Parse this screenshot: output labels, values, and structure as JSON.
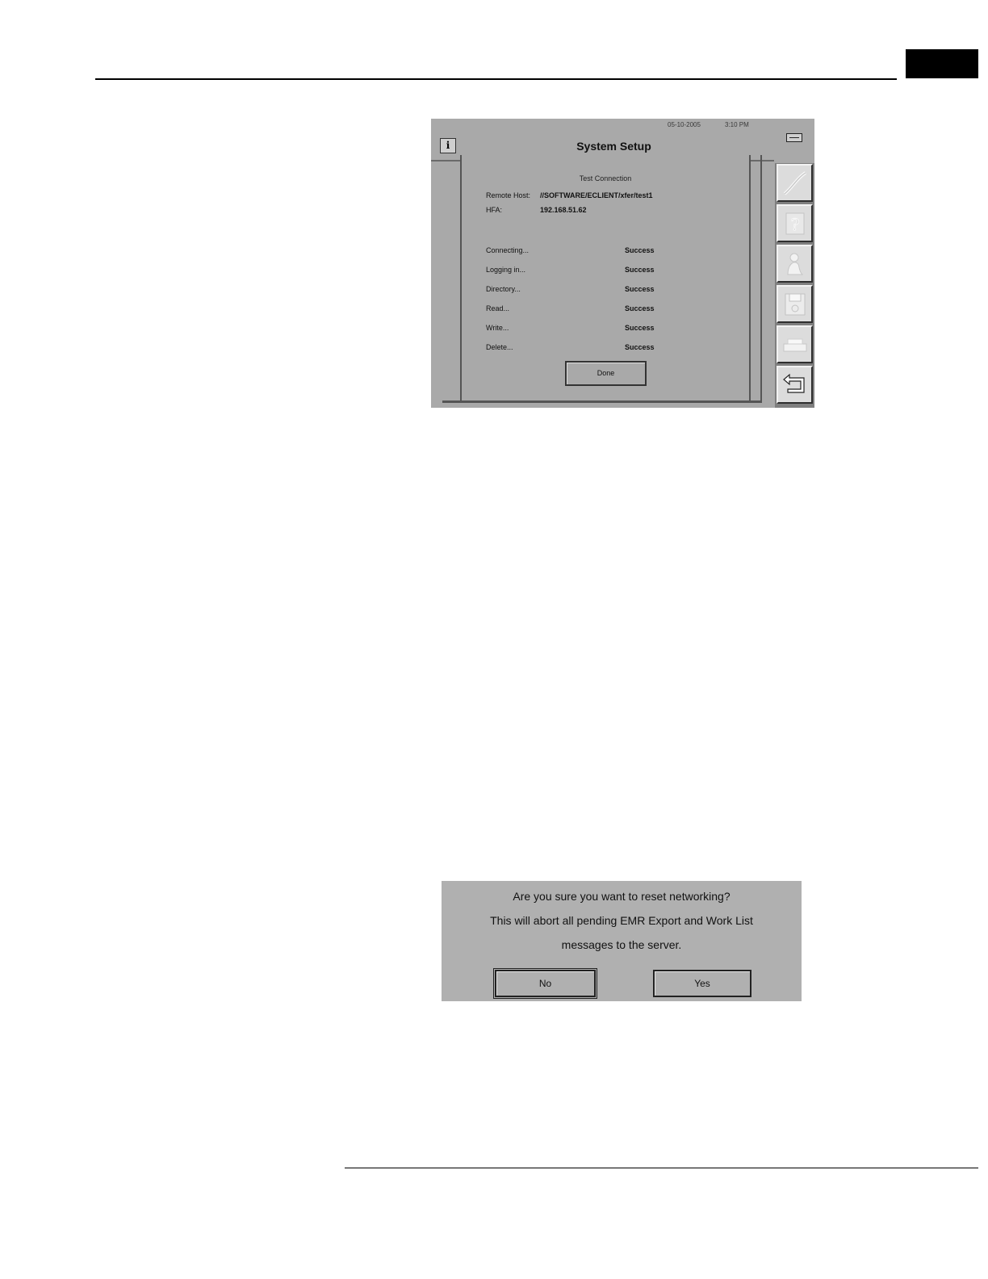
{
  "system_setup": {
    "date": "05-10-2005",
    "time": "3:10 PM",
    "info_label": "i",
    "title": "System Setup",
    "dialog_title": "Test Connection",
    "remote_host_label": "Remote Host:",
    "remote_host_value": "//SOFTWARE/ECLIENT/xfer/test1",
    "hfa_label": "HFA:",
    "hfa_value": "192.168.51.62",
    "steps": [
      {
        "label": "Connecting...",
        "status": "Success"
      },
      {
        "label": "Logging in...",
        "status": "Success"
      },
      {
        "label": "Directory...",
        "status": "Success"
      },
      {
        "label": "Read...",
        "status": "Success"
      },
      {
        "label": "Write...",
        "status": "Success"
      },
      {
        "label": "Delete...",
        "status": "Success"
      }
    ],
    "done_label": "Done",
    "side_icons": [
      "pen-icon",
      "question-icon",
      "person-icon",
      "floppy-disk-icon",
      "printer-icon",
      "return-arrow-icon"
    ]
  },
  "reset_dialog": {
    "line1": "Are you sure you want to reset networking?",
    "line2": "This will abort all pending EMR Export and Work List",
    "line3": "messages to the server.",
    "no_label": "No",
    "yes_label": "Yes"
  }
}
